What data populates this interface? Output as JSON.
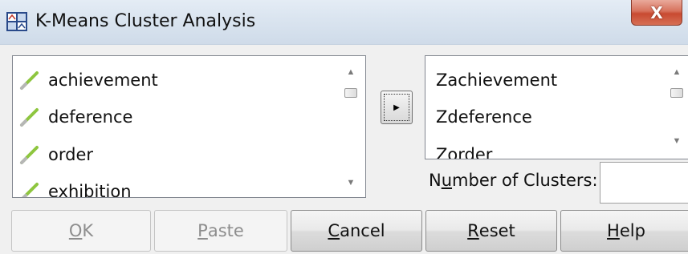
{
  "window": {
    "title": "K-Means Cluster Analysis",
    "close_label": "X"
  },
  "source_list": {
    "items": [
      {
        "label": "achievement",
        "icon": "scale-ruler-icon"
      },
      {
        "label": "deference",
        "icon": "scale-ruler-icon"
      },
      {
        "label": "order",
        "icon": "scale-ruler-icon"
      },
      {
        "label": "exhibition",
        "icon": "scale-ruler-icon"
      }
    ]
  },
  "move_button": {
    "icon": "arrow-right-icon"
  },
  "target_list": {
    "items": [
      {
        "label": "Zachievement"
      },
      {
        "label": "Zdeference"
      },
      {
        "label": "Zorder"
      }
    ]
  },
  "clusters": {
    "label_pre": "N",
    "label_mnemonic": "u",
    "label_post": "mber of Clusters:",
    "value": ""
  },
  "buttons": {
    "ok": {
      "mnemonic": "O",
      "rest": "K"
    },
    "paste": {
      "mnemonic": "P",
      "rest": "aste"
    },
    "cancel": {
      "mnemonic": "C",
      "rest": "ancel"
    },
    "reset": {
      "mnemonic": "R",
      "rest": "eset"
    },
    "help": {
      "mnemonic": "H",
      "rest": "elp"
    }
  },
  "colors": {
    "ruler_icon": "#8ec63f",
    "titlebar": "#dbe5f0",
    "close_button": "#c84a31"
  }
}
